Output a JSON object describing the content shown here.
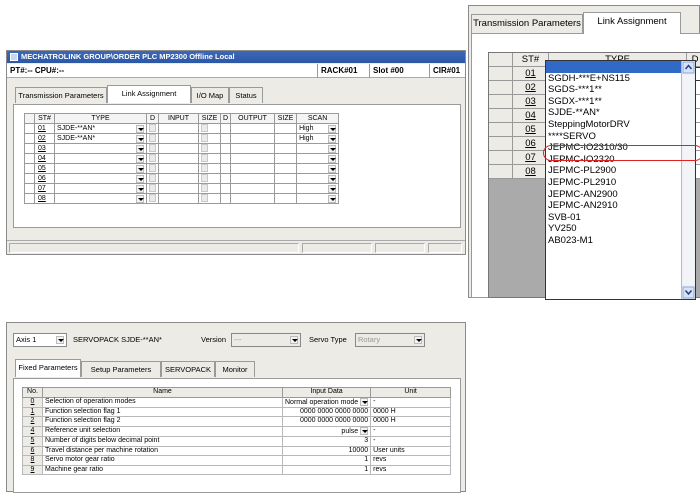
{
  "window1": {
    "title": "MECHATROLINK  GROUP\\ORDER  PLC  MP2300  Offline Local",
    "pt": "PT#:-- CPU#:--",
    "rack": "RACK#01",
    "slot": "Slot #00",
    "cir": "CIR#01",
    "tabs": [
      "Transmission Parameters",
      "Link Assignment",
      "I/O Map",
      "Status"
    ],
    "columns": [
      "ST#",
      "TYPE",
      "D",
      "INPUT",
      "SIZE",
      "D",
      "OUTPUT",
      "SIZE",
      "SCAN"
    ],
    "rows": [
      {
        "st": "01",
        "type": "SJDE-**AN*",
        "scan": "High"
      },
      {
        "st": "02",
        "type": "SJDE-**AN*",
        "scan": "High"
      },
      {
        "st": "03",
        "type": "",
        "scan": ""
      },
      {
        "st": "04",
        "type": "",
        "scan": ""
      },
      {
        "st": "05",
        "type": "",
        "scan": ""
      },
      {
        "st": "06",
        "type": "",
        "scan": ""
      },
      {
        "st": "07",
        "type": "",
        "scan": ""
      },
      {
        "st": "08",
        "type": "",
        "scan": ""
      }
    ]
  },
  "window2": {
    "tabs": [
      "Transmission Parameters",
      "Link Assignment"
    ],
    "col_st": "ST#",
    "col_type": "TYPE",
    "col_d": "D",
    "rows": [
      "01",
      "02",
      "03",
      "04",
      "05",
      "06",
      "07",
      "08"
    ],
    "options": [
      "",
      "SGDH-***E+NS115",
      "SGDS-***1**",
      "SGDX-***1**",
      "SJDE-**AN*",
      "SteppingMotorDRV",
      "****SERVO",
      "JEPMC-IO2310/30",
      "JEPMC-IO2320",
      "JEPMC-PL2900",
      "JEPMC-PL2910",
      "JEPMC-AN2900",
      "JEPMC-AN2910",
      "SVB-01",
      "YV250",
      "AB023-M1"
    ],
    "highlighted_option": "SJDE-**AN*"
  },
  "window3": {
    "axis": "Axis 1",
    "servopack": "SERVOPACK SJDE-**AN*",
    "version_label": "Version",
    "version_value": "---",
    "servo_type_label": "Servo Type",
    "servo_type_value": "Rotary",
    "tabs": [
      "Fixed Parameters",
      "Setup Parameters",
      "SERVOPACK",
      "Monitor"
    ],
    "columns": [
      "No.",
      "Name",
      "Input Data",
      "Unit"
    ],
    "rows": [
      {
        "no": "0",
        "name": "Selection of operation modes",
        "input": "Normal operation mode",
        "unit": "-"
      },
      {
        "no": "1",
        "name": "Function selection flag 1",
        "input": "0000 0000 0000 0000",
        "unit": "0000 H"
      },
      {
        "no": "2",
        "name": "Function selection flag 2",
        "input": "0000 0000 0000 0000",
        "unit": "0000 H"
      },
      {
        "no": "4",
        "name": "Reference unit selection",
        "input": "pulse",
        "unit": "-"
      },
      {
        "no": "5",
        "name": "Number of digits below decimal point",
        "input": "3",
        "unit": "-"
      },
      {
        "no": "6",
        "name": "Travel distance per machine rotation",
        "input": "10000",
        "unit": "User units"
      },
      {
        "no": "8",
        "name": "Servo motor gear ratio",
        "input": "1",
        "unit": "revs"
      },
      {
        "no": "9",
        "name": "Machine gear ratio",
        "input": "1",
        "unit": "revs"
      }
    ]
  },
  "colors": {
    "titlebar": "#2b58a6",
    "highlight": "#d22222",
    "window_bg": "#ecebe6"
  }
}
